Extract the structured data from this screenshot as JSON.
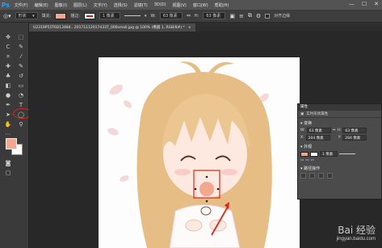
{
  "app": {
    "logo": "Ps"
  },
  "menu": [
    "文件(F)",
    "编辑(E)",
    "图像(I)",
    "图层(L)",
    "文字(Y)",
    "选择(S)",
    "滤镜(T)",
    "3D(D)",
    "视图(V)",
    "窗口(W)",
    "帮助(H)"
  ],
  "window_controls": [
    "—",
    "☐",
    "✕"
  ],
  "options_bar": {
    "mode": "形状",
    "fill_label": "填充:",
    "stroke_label": "描边:",
    "stroke_width": "1 像素",
    "w_label": "W:",
    "w_value": "63 像素",
    "h_label": "H:",
    "h_value": "63 像素",
    "align_edges": "对齐边缘"
  },
  "document_tab": {
    "title": "U2319P55T6D13484...20171112017433T_000small.jpg @ 100% (椭圆 1, RGB/8#) *",
    "close": "×"
  },
  "colors": {
    "fill": "#f2a88f",
    "stroke_swatch": "#ffffff",
    "highlight": "#e0251a",
    "accent": "#31a8ff"
  },
  "properties_panel": {
    "tab": "属性",
    "subtitle": "实时形状属性",
    "transform_section": "变换",
    "w_label": "W:",
    "w_value": "63 像素",
    "h_label": "H:",
    "h_value": "63 像素",
    "x_label": "X:",
    "x_value": "204 像素",
    "y_label": "Y:",
    "y_value": "284 像素",
    "appearance_section": "外观",
    "stroke_width": "1 像素",
    "path_ops_section": "路径操作"
  },
  "watermark": {
    "title": "Bai 经验",
    "url": "jingyan.baidu.com"
  }
}
